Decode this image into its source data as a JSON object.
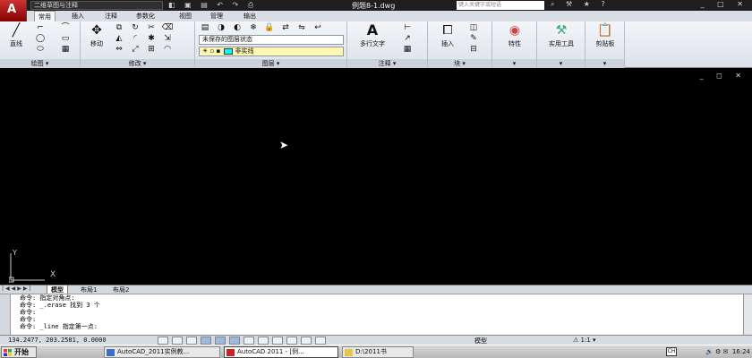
{
  "title_bar": {
    "workspace": "二维草图与注释",
    "document_title": "例题8-1.dwg",
    "search_placeholder": "键入关键字或短语"
  },
  "ribbon_tabs": [
    "常用",
    "插入",
    "注释",
    "参数化",
    "视图",
    "管理",
    "输出"
  ],
  "ribbon": {
    "draw": {
      "label": "绘图",
      "line_label": "直线"
    },
    "modify": {
      "label": "修改",
      "move_label": "移动"
    },
    "layers": {
      "label": "图层",
      "layer_state": "未保存的图层状态",
      "current_layer": "非实线"
    },
    "annotation": {
      "label": "注释",
      "mtext_label": "多行文字"
    },
    "block": {
      "label": "块",
      "insert_label": "插入"
    },
    "properties": {
      "label": "特性"
    },
    "utilities": {
      "label": "实用工具"
    },
    "clipboard": {
      "label": "剪贴板"
    }
  },
  "layout_tabs": [
    "模型",
    "布局1",
    "布局2"
  ],
  "command_history": [
    "命令: 指定对角点:",
    "命令: _.erase 找到 3 个",
    "命令:",
    "命令:",
    "命令: _line 指定第一点:"
  ],
  "status": {
    "coordinates": "134.2477, 203.2581, 0.0000",
    "model_label": "模型",
    "scale": "1:1"
  },
  "taskbar": {
    "start_label": "开始",
    "apps": [
      "AutoCAD_2011实例教...",
      "AutoCAD 2011 - [例...",
      "D:\\2011书"
    ],
    "ime": "CH",
    "clock": "16:24"
  },
  "colors": {
    "layer_color": "#00ffff",
    "app_button": "#cc2222",
    "canvas": "#000000"
  },
  "icons": [
    "undo-icon",
    "redo-icon",
    "save-icon",
    "print-icon",
    "search-icon",
    "help-icon",
    "cursor-icon",
    "ucs-icon"
  ]
}
